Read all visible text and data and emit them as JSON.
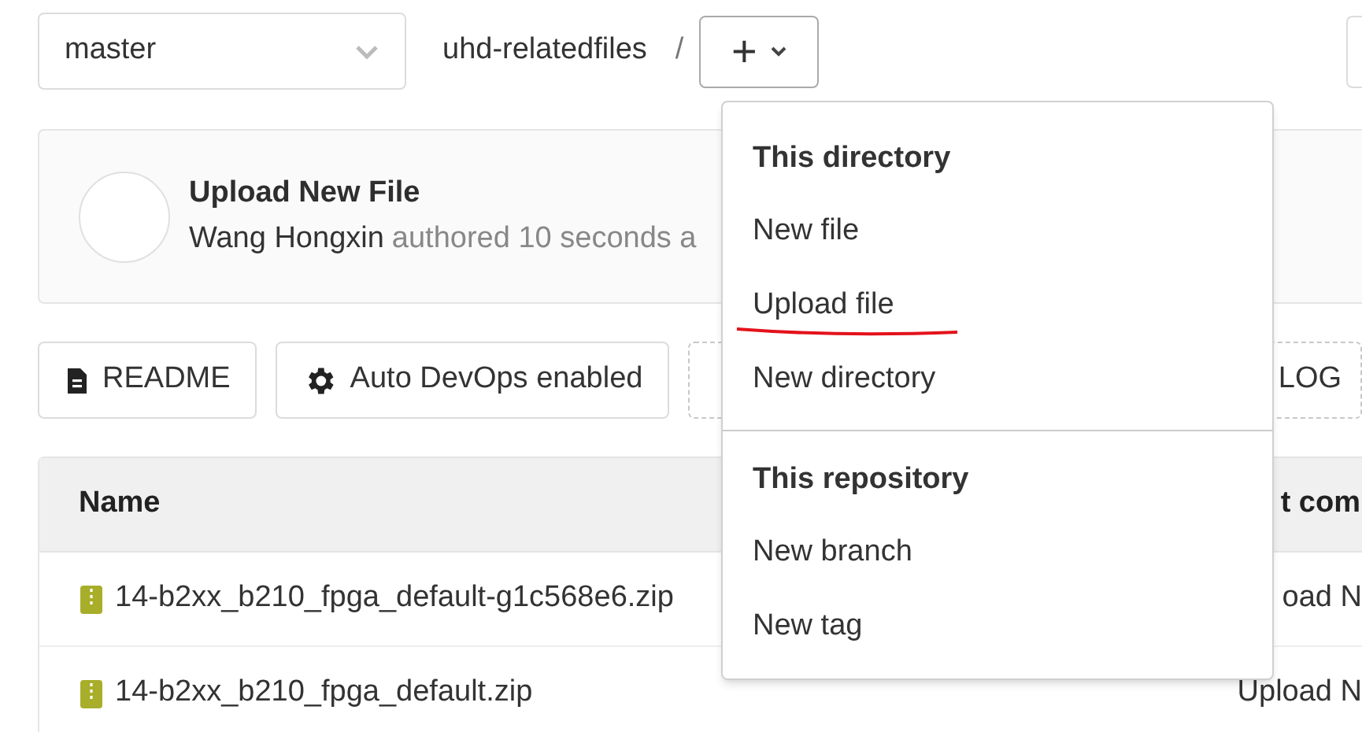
{
  "branch_selector": {
    "value": "master"
  },
  "breadcrumb": {
    "path": "uhd-relatedfiles",
    "separator": "/"
  },
  "add_button": {
    "symbol": "+",
    "expanded": true
  },
  "commit": {
    "title": "Upload New File",
    "author": "Wang Hongxin",
    "meta": "authored 10 seconds a"
  },
  "actions": [
    {
      "kind": "readme",
      "label": "README"
    },
    {
      "kind": "devops",
      "label": "Auto DevOps enabled"
    },
    {
      "kind": "dashed",
      "label": "LOG"
    }
  ],
  "table": {
    "columns": [
      "Name",
      "t com"
    ],
    "rows": [
      {
        "name": "14-b2xx_b210_fpga_default-g1c568e6.zip",
        "commit": "oad N"
      },
      {
        "name": "14-b2xx_b210_fpga_default.zip",
        "commit": "Upload N"
      }
    ]
  },
  "dropdown": {
    "sections": [
      {
        "heading": "This directory",
        "items": [
          {
            "label": "New file",
            "underlined": false
          },
          {
            "label": "Upload file",
            "underlined": true
          },
          {
            "label": "New directory",
            "underlined": false
          }
        ]
      },
      {
        "heading": "This repository",
        "items": [
          {
            "label": "New branch",
            "underlined": false
          },
          {
            "label": "New tag",
            "underlined": false
          }
        ]
      }
    ]
  }
}
